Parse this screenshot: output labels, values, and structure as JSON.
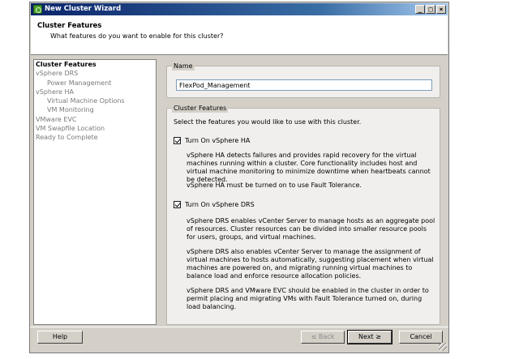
{
  "window": {
    "title": "New Cluster Wizard",
    "minimize": "_",
    "maximize": "□",
    "close": "×"
  },
  "header": {
    "title": "Cluster Features",
    "subtitle": "What features do you want to enable for this cluster?"
  },
  "nav": {
    "items": [
      {
        "label": "Cluster Features"
      },
      {
        "label": "vSphere DRS"
      },
      {
        "label": "Power Management"
      },
      {
        "label": "vSphere HA"
      },
      {
        "label": "Virtual Machine Options"
      },
      {
        "label": "VM Monitoring"
      },
      {
        "label": "VMware EVC"
      },
      {
        "label": "VM Swapfile Location"
      },
      {
        "label": "Ready to Complete"
      }
    ]
  },
  "name_group": {
    "legend": "Name",
    "value": "FlexPod_Management"
  },
  "features_group": {
    "legend": "Cluster Features",
    "intro": "Select the features you would like to use with this cluster.",
    "ha": {
      "label": "Turn On vSphere HA",
      "checked": true,
      "desc1": "vSphere HA detects failures and provides rapid recovery for the virtual machines running within a cluster. Core functionality includes host and virtual machine monitoring to minimize downtime when heartbeats cannot be detected.",
      "desc2": "vSphere HA must be turned on to use Fault Tolerance."
    },
    "drs": {
      "label": "Turn On vSphere DRS",
      "checked": true,
      "desc1": "vSphere DRS enables vCenter Server to manage hosts as an aggregate pool of resources. Cluster resources can be divided into smaller resource pools for users, groups, and virtual machines.",
      "desc2": "vSphere DRS also enables vCenter Server to manage the assignment of virtual machines to hosts automatically, suggesting placement when virtual machines are powered on, and migrating running virtual machines to balance load and enforce resource allocation policies.",
      "desc3": "vSphere DRS and VMware EVC should be enabled in the cluster in order to permit placing and migrating VMs with Fault Tolerance turned on, during load balancing."
    }
  },
  "footer": {
    "help": "Help",
    "back": "≤ Back",
    "next": "Next ≥",
    "cancel": "Cancel"
  }
}
